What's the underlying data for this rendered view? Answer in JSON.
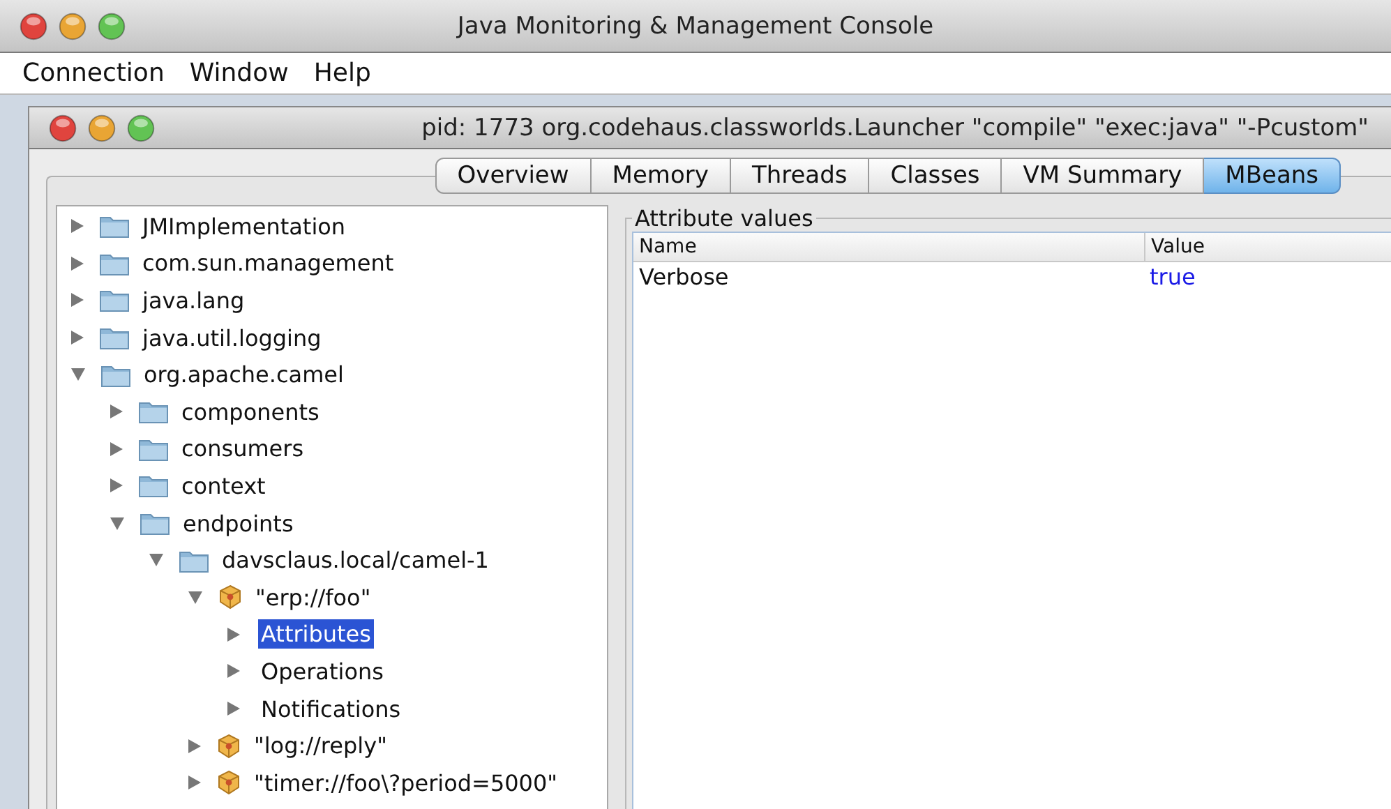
{
  "window": {
    "title": "Java Monitoring & Management Console"
  },
  "menu": [
    "Connection",
    "Window",
    "Help"
  ],
  "inner_window": {
    "title": "pid: 1773 org.codehaus.classworlds.Launcher \"compile\" \"exec:java\" \"-Pcustom\""
  },
  "tabs": [
    {
      "label": "Overview",
      "selected": false
    },
    {
      "label": "Memory",
      "selected": false
    },
    {
      "label": "Threads",
      "selected": false
    },
    {
      "label": "Classes",
      "selected": false
    },
    {
      "label": "VM Summary",
      "selected": false
    },
    {
      "label": "MBeans",
      "selected": true
    }
  ],
  "tree": [
    {
      "label": "JMImplementation",
      "kind": "folder",
      "expanded": false,
      "selected": false
    },
    {
      "label": "com.sun.management",
      "kind": "folder",
      "expanded": false,
      "selected": false
    },
    {
      "label": "java.lang",
      "kind": "folder",
      "expanded": false,
      "selected": false
    },
    {
      "label": "java.util.logging",
      "kind": "folder",
      "expanded": false,
      "selected": false
    },
    {
      "label": "org.apache.camel",
      "kind": "folder",
      "expanded": true,
      "selected": false,
      "children": [
        {
          "label": "components",
          "kind": "folder",
          "expanded": false,
          "selected": false
        },
        {
          "label": "consumers",
          "kind": "folder",
          "expanded": false,
          "selected": false
        },
        {
          "label": "context",
          "kind": "folder",
          "expanded": false,
          "selected": false
        },
        {
          "label": "endpoints",
          "kind": "folder",
          "expanded": true,
          "selected": false,
          "children": [
            {
              "label": "davsclaus.local/camel-1",
              "kind": "folder",
              "expanded": true,
              "selected": false,
              "children": [
                {
                  "label": "\"erp://foo\"",
                  "kind": "bean",
                  "expanded": true,
                  "selected": false,
                  "children": [
                    {
                      "label": "Attributes",
                      "kind": "leaf",
                      "expanded": false,
                      "selected": true
                    },
                    {
                      "label": "Operations",
                      "kind": "leaf",
                      "expanded": false,
                      "selected": false
                    },
                    {
                      "label": "Notifications",
                      "kind": "leaf",
                      "expanded": false,
                      "selected": false
                    }
                  ]
                },
                {
                  "label": "\"log://reply\"",
                  "kind": "bean",
                  "expanded": false,
                  "selected": false
                },
                {
                  "label": "\"timer://foo\\?period=5000\"",
                  "kind": "bean",
                  "expanded": false,
                  "selected": false
                }
              ]
            }
          ]
        }
      ]
    }
  ],
  "attributes": {
    "title": "Attribute values",
    "columns": [
      "Name",
      "Value"
    ],
    "rows": [
      [
        "Verbose",
        "true"
      ]
    ]
  }
}
